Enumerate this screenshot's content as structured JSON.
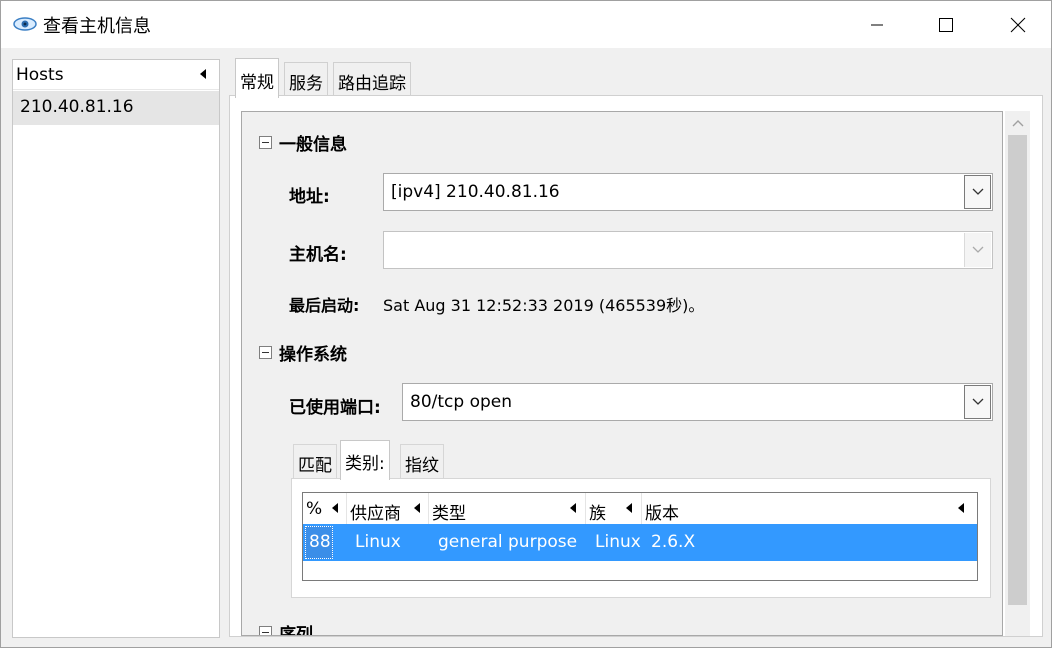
{
  "window": {
    "title": "查看主机信息",
    "icon": "eye-icon"
  },
  "hosts_panel": {
    "header": "Hosts",
    "hosts": [
      "210.40.81.16"
    ]
  },
  "tabs": [
    "常规",
    "服务",
    "路由追踪"
  ],
  "general_info": {
    "section_title": "一般信息",
    "address_label": "地址:",
    "address_value": "[ipv4] 210.40.81.16",
    "hostname_label": "主机名:",
    "hostname_value": "",
    "last_boot_label": "最后启动:",
    "last_boot_value": "Sat Aug 31 12:52:33 2019 (465539秒)。"
  },
  "os": {
    "section_title": "操作系统",
    "ports_label": "已使用端口:",
    "ports_value": "80/tcp open",
    "subtabs": [
      "匹配",
      "类别:",
      "指纹"
    ],
    "table": {
      "columns": [
        "%",
        "供应商",
        "类型",
        "族",
        "版本"
      ],
      "rows": [
        {
          "percent": "88",
          "vendor": "Linux",
          "type": "general purpose",
          "family": "Linux",
          "version": "2.6.X"
        }
      ]
    }
  },
  "next_section_title": "序列",
  "colors": {
    "selection": "#3399ff",
    "window_bg": "#f0f0f0"
  }
}
